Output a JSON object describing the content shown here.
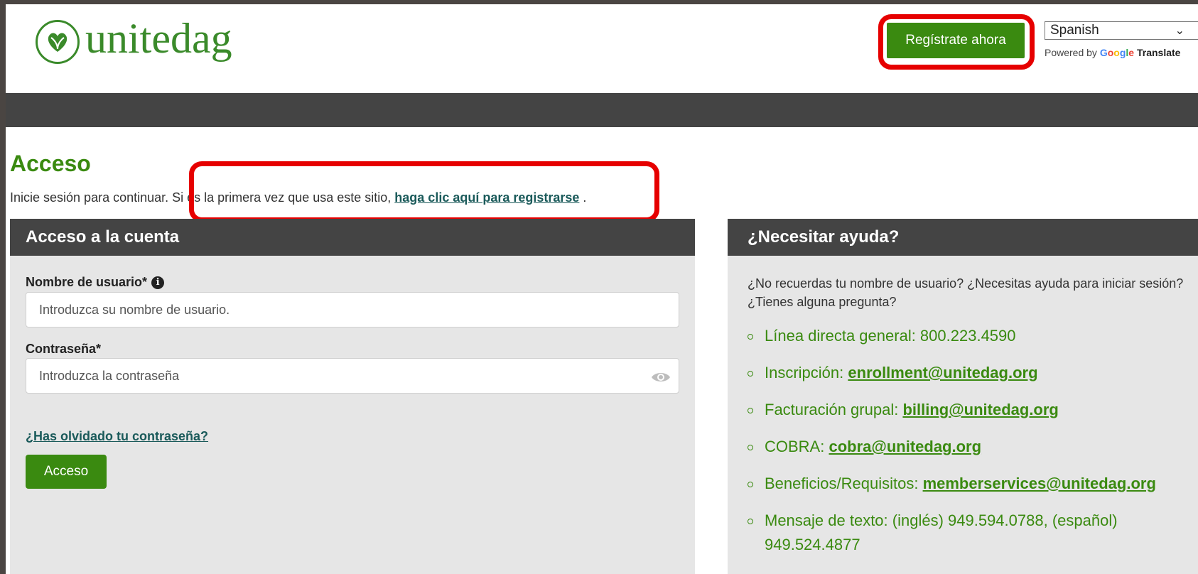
{
  "header": {
    "logo_text": "unitedag",
    "register_label": "Regístrate ahora",
    "language": {
      "selected": "Spanish",
      "powered_by": "Powered by",
      "google": "Google",
      "translate": "Translate"
    }
  },
  "login": {
    "title": "Acceso",
    "intro_prefix": "Inicie sesión para continuar.",
    "intro_middle": " Si es la primera vez que usa este sitio, ",
    "intro_link": "haga clic aquí para registrarse",
    "intro_suffix": " .",
    "panel_title": "Acceso a la cuenta",
    "username_label": "Nombre de usuario*",
    "username_placeholder": "Introduzca su nombre de usuario.",
    "password_label": "Contraseña*",
    "password_placeholder": "Introduzca la contraseña",
    "forgot_label": "¿Has olvidado tu contraseña?",
    "submit_label": "Acceso"
  },
  "help": {
    "title": "¿Necesitar ayuda?",
    "description": "¿No recuerdas tu nombre de usuario? ¿Necesitas ayuda para iniciar sesión? ¿Tienes alguna pregunta?",
    "items": [
      {
        "label": "Línea directa general: 800.223.4590",
        "link": ""
      },
      {
        "label": "Inscripción: ",
        "link": "enrollment@unitedag.org"
      },
      {
        "label": "Facturación grupal: ",
        "link": "billing@unitedag.org"
      },
      {
        "label": "COBRA: ",
        "link": "cobra@unitedag.org"
      },
      {
        "label": "Beneficios/Requisitos: ",
        "link": "memberservices@unitedag.org"
      },
      {
        "label": "Mensaje de texto: (inglés) 949.594.0788, (español) 949.524.4877",
        "link": ""
      }
    ]
  },
  "colors": {
    "brand_green": "#3a8a10",
    "dark_bar": "#444444",
    "highlight": "#e60000"
  }
}
